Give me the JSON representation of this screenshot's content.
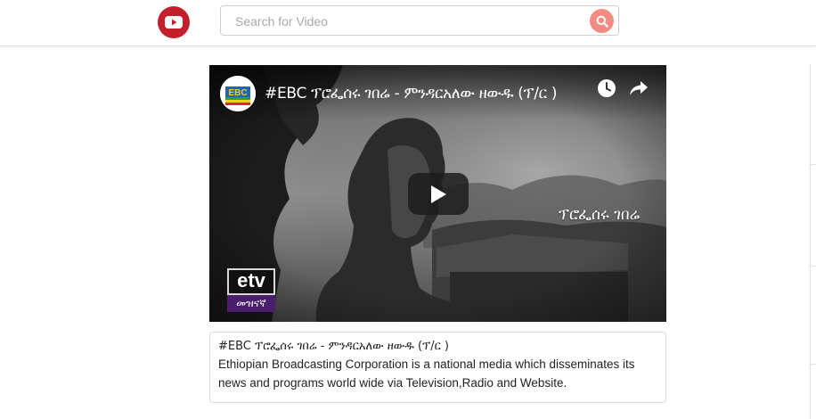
{
  "header": {
    "logo_icon": "youtube-play-icon",
    "search": {
      "placeholder": "Search for Video",
      "value": "",
      "button_icon": "search-icon"
    }
  },
  "player": {
    "channel_logo": "EBC",
    "title": "#EBC ፕሮፌሰሩ ገበሬ - ምንዳርአለው ዘውዱ (ፕ/ር )",
    "watch_later_icon": "clock-icon",
    "share_icon": "share-arrow-icon",
    "play_icon": "play-icon",
    "overlay_caption": "ፕሮፌሰሩ ገበሬ",
    "watermark": {
      "top": "etv",
      "bottom": "መዝናኛ"
    }
  },
  "description": {
    "title": "#EBC ፕሮፌሰሩ ገበሬ - ምንዳርአለው ዘውዱ (ፕ/ር )",
    "text": "Ethiopian Broadcasting Corporation is a national media which disseminates its news and programs world wide via Television,Radio and Website."
  },
  "colors": {
    "brand_red": "#c4202c",
    "search_button": "#f28b82"
  }
}
